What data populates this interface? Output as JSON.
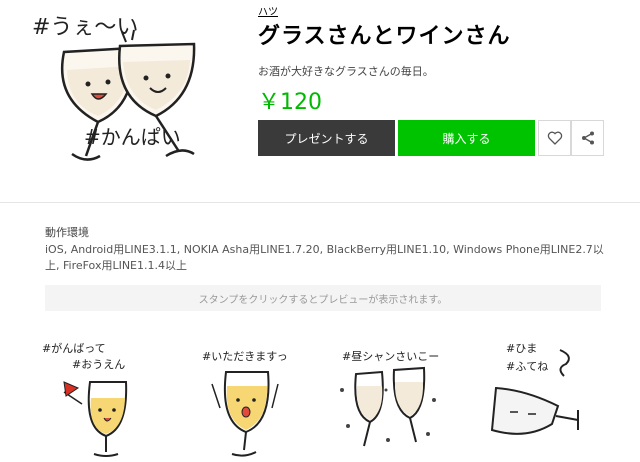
{
  "product": {
    "author": "ハツ",
    "title": "グラスさんとワインさん",
    "description": "お酒が大好きなグラスさんの毎日。",
    "price": "￥120",
    "main_image_text": {
      "top": "#うぇ～い",
      "bottom": "#かんぱい"
    }
  },
  "actions": {
    "gift_label": "プレゼントする",
    "buy_label": "購入する",
    "like_icon": "heart-icon",
    "share_icon": "share-icon"
  },
  "environment": {
    "label": "動作環境",
    "text": "iOS, Android用LINE3.1.1, NOKIA Asha用LINE1.7.20, BlackBerry用LINE1.10, Windows Phone用LINE2.7以上, FireFox用LINE1.1.4以上"
  },
  "preview_hint": "スタンプをクリックするとプレビューが表示されます。",
  "stickers": [
    {
      "name": "sticker-cheer",
      "text_line1": "#がんばって",
      "text_line2": "#おうえん"
    },
    {
      "name": "sticker-itadakimasu",
      "text_line1": "#いただきますっ",
      "text_line2": ""
    },
    {
      "name": "sticker-party",
      "text_line1": "#昼シャンさいこー",
      "text_line2": ""
    },
    {
      "name": "sticker-bored",
      "text_line1": "#ひま",
      "text_line2": "#ふてね"
    }
  ],
  "colors": {
    "price": "#00b900",
    "buy_button": "#00c300",
    "gift_button": "#3a3a3a"
  }
}
